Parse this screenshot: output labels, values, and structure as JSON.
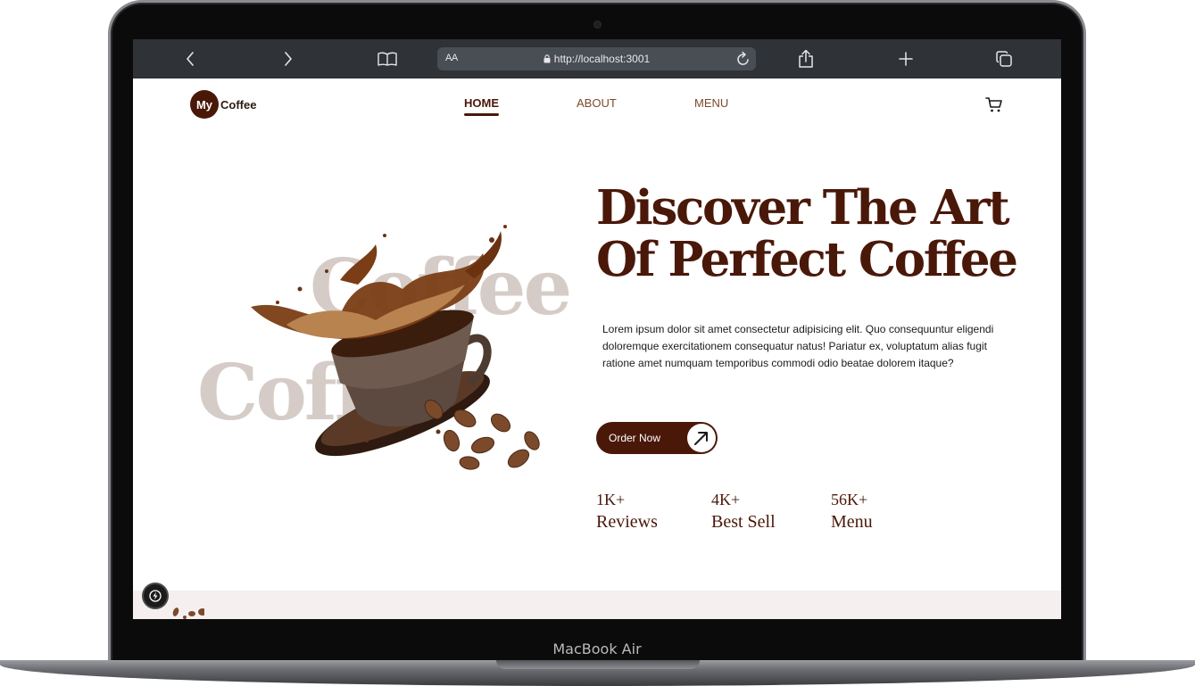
{
  "device": {
    "model_label": "MacBook Air"
  },
  "browser": {
    "reader_label": "AA",
    "url": "http://localhost:3001",
    "icons": {
      "back": "chevron-left-icon",
      "forward": "chevron-right-icon",
      "bookmarks": "book-icon",
      "lock": "lock-icon",
      "reload": "reload-icon",
      "share": "share-icon",
      "new_tab": "plus-icon",
      "tabs": "tabs-icon"
    }
  },
  "nav": {
    "logo_mark": "My",
    "logo_text": "Coffee",
    "links": [
      {
        "label": "HOME",
        "active": true
      },
      {
        "label": "ABOUT",
        "active": false
      },
      {
        "label": "MENU",
        "active": false
      }
    ],
    "cart_icon": "cart-icon"
  },
  "hero": {
    "ghost_words": [
      "Coffee",
      "Coffee"
    ],
    "title_line1": "Discover The Art",
    "title_line2": "Of Perfect Coffee",
    "description": "Lorem ipsum dolor sit amet consectetur adipisicing elit. Quo consequuntur eligendi doloremque exercitationem consequatur natus! Pariatur ex, voluptatum alias fugit ratione amet numquam temporibus commodi odio beatae dolorem itaque?",
    "cta_label": "Order Now",
    "cta_icon": "arrow-up-right-icon",
    "stats": [
      {
        "value": "1K+",
        "label": "Reviews"
      },
      {
        "value": "4K+",
        "label": "Best Sell"
      },
      {
        "value": "56K+",
        "label": "Menu"
      }
    ]
  },
  "colors": {
    "brand_brown": "#4a1809",
    "ghost_text": "#d6ccc7",
    "browser_bar": "#2f3237",
    "section_tint": "#f5f0ef"
  }
}
